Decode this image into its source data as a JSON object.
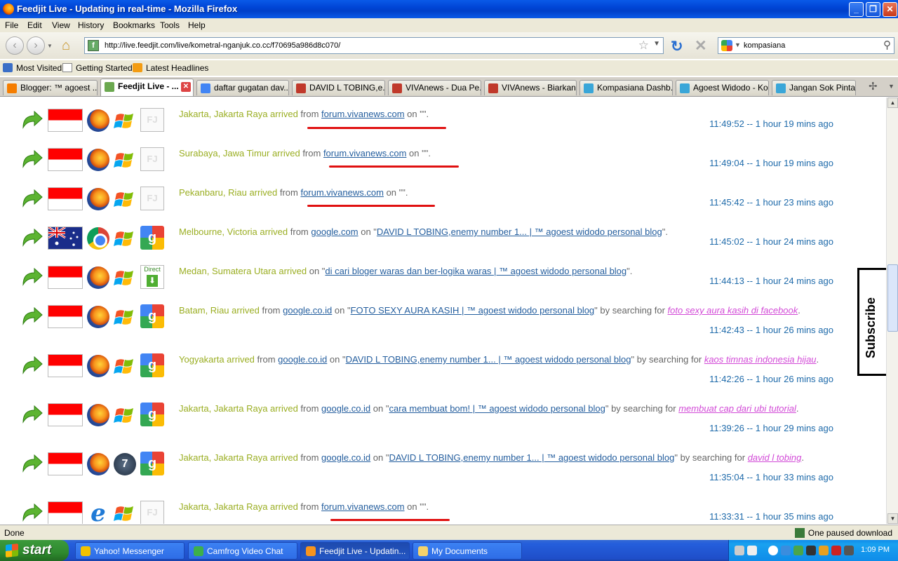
{
  "window": {
    "title": "Feedjit Live - Updating in real-time - Mozilla Firefox"
  },
  "menu": [
    "File",
    "Edit",
    "View",
    "History",
    "Bookmarks",
    "Tools",
    "Help"
  ],
  "nav": {
    "url": "http://live.feedjit.com/live/kometral-nganjuk.co.cc/f70695a986d8c070/",
    "search_value": "kompasiana"
  },
  "bookmarks": [
    "Most Visited",
    "Getting Started",
    "Latest Headlines"
  ],
  "tabs": [
    {
      "label": "Blogger: ™ agoest ...",
      "color": "#f57d00"
    },
    {
      "label": "Feedjit Live - ...",
      "color": "#6aa84f",
      "active": true
    },
    {
      "label": "daftar gugatan dav...",
      "color": "#4285f4"
    },
    {
      "label": "DAVID L TOBING,e...",
      "color": "#c0392b"
    },
    {
      "label": "VIVAnews - Dua Pe...",
      "color": "#c0392b"
    },
    {
      "label": "VIVAnews - Biarkan...",
      "color": "#c0392b"
    },
    {
      "label": "Kompasiana Dashb...",
      "color": "#3aa6d8"
    },
    {
      "label": "Agoest Widodo - Ko...",
      "color": "#3aa6d8"
    },
    {
      "label": "Jangan Sok Pintar",
      "color": "#3aa6d8"
    }
  ],
  "visits": [
    {
      "flag": "id",
      "browser": "firefox",
      "os": "xp",
      "ref": "fj",
      "location": "Jakarta, Jakarta Raya arrived",
      "from_label": "from",
      "source": "forum.vivanews.com",
      "on_label": "on",
      "page": "",
      "search_label": "",
      "keyword": "",
      "time": "11:49:52 -- 1 hour 19 mins ago"
    },
    {
      "flag": "id",
      "browser": "firefox",
      "os": "xp",
      "ref": "fj",
      "location": "Surabaya, Jawa Timur arrived",
      "from_label": "from",
      "source": "forum.vivanews.com",
      "on_label": "on",
      "page": "",
      "search_label": "",
      "keyword": "",
      "time": "11:49:04 -- 1 hour 19 mins ago"
    },
    {
      "flag": "id",
      "browser": "firefox",
      "os": "xp",
      "ref": "fj",
      "location": "Pekanbaru, Riau arrived",
      "from_label": "from",
      "source": "forum.vivanews.com",
      "on_label": "on",
      "page": "",
      "search_label": "",
      "keyword": "",
      "time": "11:45:42 -- 1 hour 23 mins ago"
    },
    {
      "flag": "au",
      "browser": "chrome",
      "os": "xp",
      "ref": "google",
      "location": "Melbourne, Victoria arrived",
      "from_label": "from",
      "source": "google.com",
      "on_label": "on",
      "page": "DAVID L TOBING,enemy number 1... | ™ agoest widodo personal blog",
      "search_label": "",
      "keyword": "",
      "time": "11:45:02 -- 1 hour 24 mins ago"
    },
    {
      "flag": "id",
      "browser": "firefox",
      "os": "xp",
      "ref": "direct",
      "location": "Medan, Sumatera Utara arrived",
      "from_label": "",
      "source": "",
      "on_label": "on",
      "page": "di cari bloger waras dan ber-logika waras | ™ agoest widodo personal blog",
      "search_label": "",
      "keyword": "",
      "time": "11:44:13 -- 1 hour 24 mins ago"
    },
    {
      "flag": "id",
      "browser": "firefox",
      "os": "xp",
      "ref": "google",
      "location": "Batam, Riau arrived",
      "from_label": "from",
      "source": "google.co.id",
      "on_label": "on",
      "page": "FOTO SEXY AURA KASIH | ™ agoest widodo personal blog",
      "search_label": "by searching for",
      "keyword": "foto sexy aura kasih di facebook",
      "time": "11:42:43 -- 1 hour 26 mins ago"
    },
    {
      "flag": "id",
      "browser": "firefox",
      "os": "xp",
      "ref": "google",
      "location": "Yogyakarta arrived",
      "from_label": "from",
      "source": "google.co.id",
      "on_label": "on",
      "page": "DAVID L TOBING,enemy number 1... | ™ agoest widodo personal blog",
      "search_label": "by searching for",
      "keyword": "kaos timnas indonesia hijau",
      "time": "11:42:26 -- 1 hour 26 mins ago"
    },
    {
      "flag": "id",
      "browser": "firefox",
      "os": "xp",
      "ref": "google",
      "location": "Jakarta, Jakarta Raya arrived",
      "from_label": "from",
      "source": "google.co.id",
      "on_label": "on",
      "page": "cara membuat bom! | ™ agoest widodo personal blog",
      "search_label": "by searching for",
      "keyword": "membuat cap dari ubi tutorial",
      "time": "11:39:26 -- 1 hour 29 mins ago"
    },
    {
      "flag": "id",
      "browser": "firefox",
      "os": "win7",
      "ref": "google",
      "location": "Jakarta, Jakarta Raya arrived",
      "from_label": "from",
      "source": "google.co.id",
      "on_label": "on",
      "page": "DAVID L TOBING,enemy number 1... | ™ agoest widodo personal blog",
      "search_label": "by searching for",
      "keyword": "david l tobing",
      "time": "11:35:04 -- 1 hour 33 mins ago"
    },
    {
      "flag": "id",
      "browser": "ie",
      "os": "xp",
      "ref": "fj",
      "location": "Jakarta, Jakarta Raya arrived",
      "from_label": "from",
      "source": "forum.vivanews.com",
      "on_label": "on",
      "page": "",
      "search_label": "",
      "keyword": "",
      "time": "11:33:31 -- 1 hour 35 mins ago"
    }
  ],
  "subscribe_label": "Subscribe",
  "direct_label": "Direct",
  "status": {
    "text": "Done",
    "download": "One paused download"
  },
  "taskbar": {
    "start": "start",
    "tasks": [
      {
        "label": "Yahoo! Messenger",
        "color": "#f2c200"
      },
      {
        "label": "Camfrog Video Chat",
        "color": "#3db04a"
      },
      {
        "label": "Feedjit Live - Updatin...",
        "color": "#f7941d",
        "active": true
      },
      {
        "label": "My Documents",
        "color": "#f5d36b"
      }
    ],
    "clock": "1:09 PM"
  }
}
